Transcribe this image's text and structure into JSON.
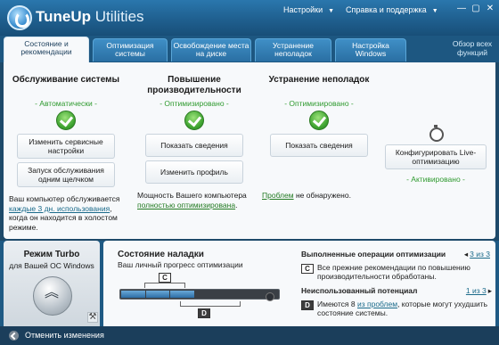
{
  "app": {
    "brand_bold": "TuneUp",
    "brand_light": " Utilities"
  },
  "titlebar": {
    "settings": "Настройки",
    "help": "Справка и поддержка"
  },
  "tabs": [
    {
      "label": "Состояние и рекомендации"
    },
    {
      "label": "Оптимизация системы"
    },
    {
      "label": "Освобождение места на диске"
    },
    {
      "label": "Устранение неполадок"
    },
    {
      "label": "Настройка Windows"
    }
  ],
  "tab_more": "Обзор всех функций",
  "columns": {
    "maintenance": {
      "title": "Обслуживание системы",
      "status": "- Автоматически -",
      "btn1": "Изменить сервисные настройки",
      "btn2": "Запуск обслуживания одним щелчком",
      "text_a": "Ваш компьютер обслуживается ",
      "text_link": "каждые 3 дн. использования",
      "text_b": ", когда он находится в холостом режиме."
    },
    "performance": {
      "title": "Повышение производительности",
      "status": "- Оптимизировано -",
      "btn1": "Показать сведения",
      "btn2": "Изменить профиль",
      "text_a": "Мощность Вашего компьютера ",
      "text_link": "полностью оптимизирована",
      "text_b": "."
    },
    "troubleshoot": {
      "title": "Устранение неполадок",
      "status": "- Оптимизировано -",
      "btn1": "Показать сведения",
      "text_link": "Проблем",
      "text_b": " не обнаружено."
    },
    "live": {
      "btn": "Конфигурировать Live-оптимизацию",
      "status": "- Активировано -"
    }
  },
  "turbo": {
    "title": "Режим Turbo",
    "subtitle": "для Вашей ОС Windows"
  },
  "tuning": {
    "title": "Состояние наладки",
    "subtitle": "Ваш личный прогресс оптимизации",
    "progress_done": 0.47,
    "marker_c": "C",
    "marker_d": "D"
  },
  "ops": {
    "done_title": "Выполненные операции оптимизации",
    "done_nav": "3 из 3",
    "done_text": "Все прежние рекомендации по повышению производительности обработаны.",
    "unused_title": "Неиспользованный потенциал",
    "unused_nav": "1 из 3",
    "unused_text_a": "Имеются 8 ",
    "unused_link": "из проблем",
    "unused_text_b": ", которые могут ухудшить состояние системы."
  },
  "footer": {
    "undo": "Отменить изменения"
  },
  "colors": {
    "accent": "#1f5a84",
    "ok_green": "#2f9a2f",
    "link": "#1a6a8a"
  }
}
